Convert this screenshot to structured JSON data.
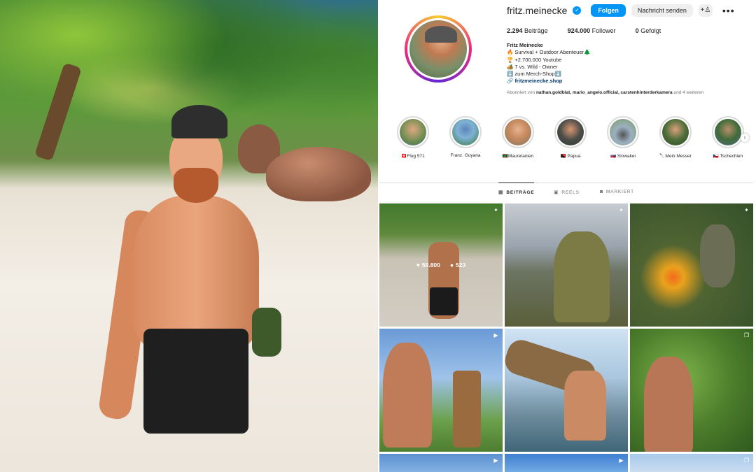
{
  "profile": {
    "username": "fritz.meinecke",
    "follow_label": "Folgen",
    "message_label": "Nachricht senden",
    "adduser_icon": "add-user-icon",
    "more_icon": "more-options-icon",
    "stats": {
      "posts_count": "2.294",
      "posts_label": "Beiträge",
      "followers_count": "924.000",
      "followers_label": "Follower",
      "following_count": "0",
      "following_label": "Gefolgt"
    },
    "bio": {
      "name": "Fritz Meinecke",
      "line1": "🔥 Survival + Outdoor Abenteuer🌲",
      "line2": "🏆 +2.700.000 Youtube",
      "line3": "🏕️ 7 vs. Wild - Owner",
      "line4": "⬇️ zum Merch-Shop⬇️",
      "link": "fritzmeinecke.shop"
    },
    "followed_by": {
      "prefix": "Abonniert von",
      "names": "nathan.goldblat, mario_angelo.official, carstenhinterderkamera",
      "suffix": "und 4 weiteren"
    }
  },
  "highlights": [
    {
      "label": "🇨🇭Flug 571"
    },
    {
      "label": "Franz. Guyana"
    },
    {
      "label": "🇲🇷Mauretanien"
    },
    {
      "label": "🇵🇬 Papua"
    },
    {
      "label": "🇸🇰 Slowakei"
    },
    {
      "label": "🔪Mein Messer"
    },
    {
      "label": "🇨🇿 Tschechien"
    }
  ],
  "tabs": [
    {
      "label": "BEITRÄGE",
      "icon": "grid-icon"
    },
    {
      "label": "REELS",
      "icon": "reels-icon"
    },
    {
      "label": "MARKIERT",
      "icon": "tagged-icon"
    }
  ],
  "posts": {
    "hover": {
      "likes": "59.800",
      "comments": "523"
    }
  },
  "colors": {
    "accent": "#0095f6",
    "link": "#00376b"
  }
}
